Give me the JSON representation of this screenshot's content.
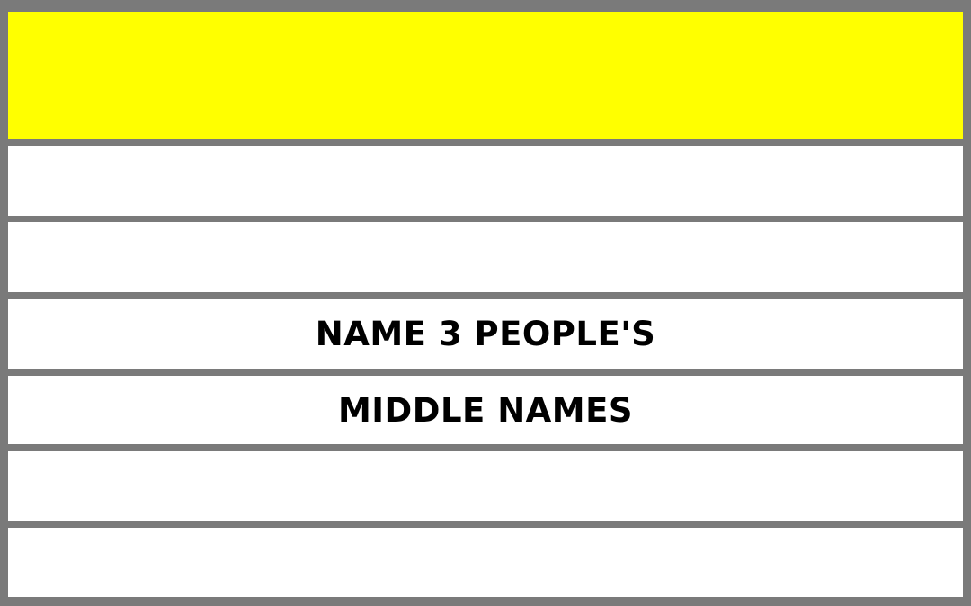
{
  "header": {
    "color": "#ffff00",
    "text": ""
  },
  "rows": [
    {
      "text": ""
    },
    {
      "text": ""
    },
    {
      "text": "NAME 3 PEOPLE'S"
    },
    {
      "text": "MIDDLE NAMES"
    },
    {
      "text": ""
    },
    {
      "text": ""
    }
  ],
  "colors": {
    "frame": "#7a7a7a",
    "row_background": "#ffffff",
    "text": "#000000"
  }
}
